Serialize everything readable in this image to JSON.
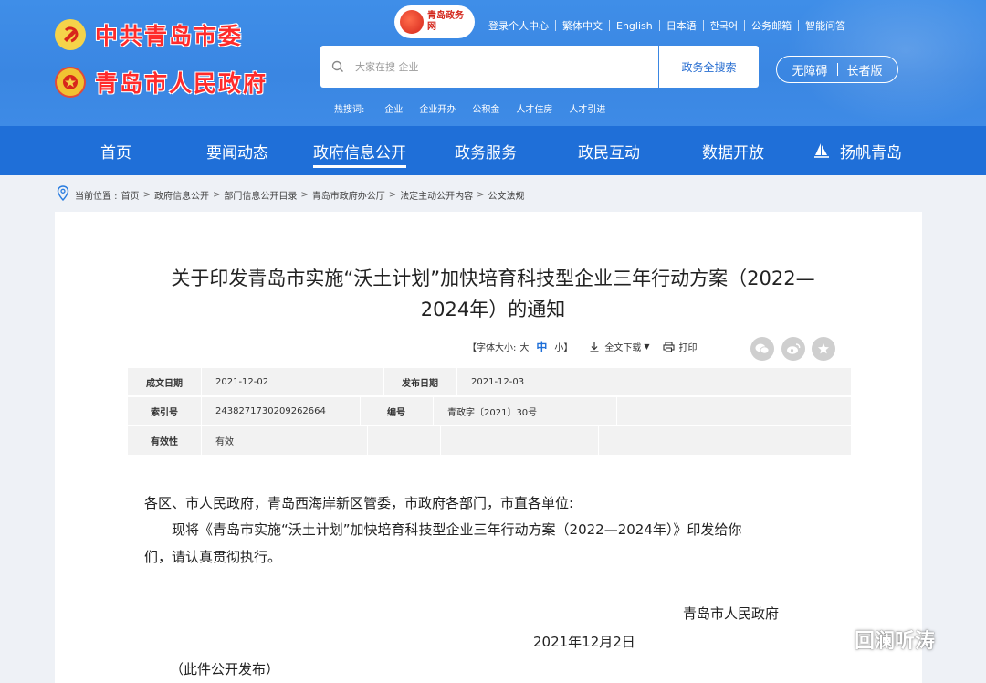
{
  "header": {
    "party_name": "中共青岛市委",
    "gov_name": "青岛市人民政府",
    "logo_text": "青岛政务网",
    "top_links": [
      "登录个人中心",
      "繁体中文",
      "English",
      "日本语",
      "한국어",
      "公务邮箱",
      "智能问答"
    ],
    "search": {
      "placeholder": "大家在搜 企业",
      "button_label": "政务全搜索"
    },
    "access": {
      "barrier_free": "无障碍",
      "elder": "长者版"
    },
    "hot": {
      "label": "热搜词:",
      "words": [
        "企业",
        "企业开办",
        "公积金",
        "人才住房",
        "人才引进"
      ]
    }
  },
  "nav": {
    "items": [
      "首页",
      "要闻动态",
      "政府信息公开",
      "政务服务",
      "政民互动",
      "数据开放",
      "扬帆青岛"
    ],
    "active_index": 2
  },
  "breadcrumb": {
    "prefix": "当前位置 :",
    "items": [
      "首页",
      "政府信息公开",
      "部门信息公开目录",
      "青岛市政府办公厅",
      "法定主动公开内容",
      "公文法规"
    ]
  },
  "document": {
    "title_line1": "关于印发青岛市实施“沃土计划”加快培育科技型企业三年行动方案（2022—",
    "title_line2": "2024年）的通知",
    "tools": {
      "font_label": "【字体大小:",
      "size_large": "大",
      "size_medium": "中",
      "size_small": "小】",
      "download": "全文下载",
      "print": "打印"
    },
    "meta": {
      "written_date_label": "成文日期",
      "written_date": "2021-12-02",
      "publish_date_label": "发布日期",
      "publish_date": "2021-12-03",
      "index_label": "索引号",
      "index": "2438271730209262664",
      "number_label": "编号",
      "number": "青政字〔2021〕30号",
      "validity_label": "有效性",
      "validity": "有效"
    },
    "salutation": "各区、市人民政府，青岛西海岸新区管委，市政府各部门，市直各单位:",
    "body_line1": "现将《青岛市实施“沃土计划”加快培育科技型企业三年行动方案（2022—2024年）》印发给你",
    "body_line2": "们，请认真贯彻执行。",
    "signer": "青岛市人民政府",
    "sign_date": "2021年12月2日",
    "note": "（此件公开发布）"
  },
  "watermark": {
    "text": "回澜听涛"
  },
  "colors": {
    "header_bg": "#3a86e2",
    "nav_bg": "#1f6fd8",
    "brand_red": "#ff2b2b"
  }
}
